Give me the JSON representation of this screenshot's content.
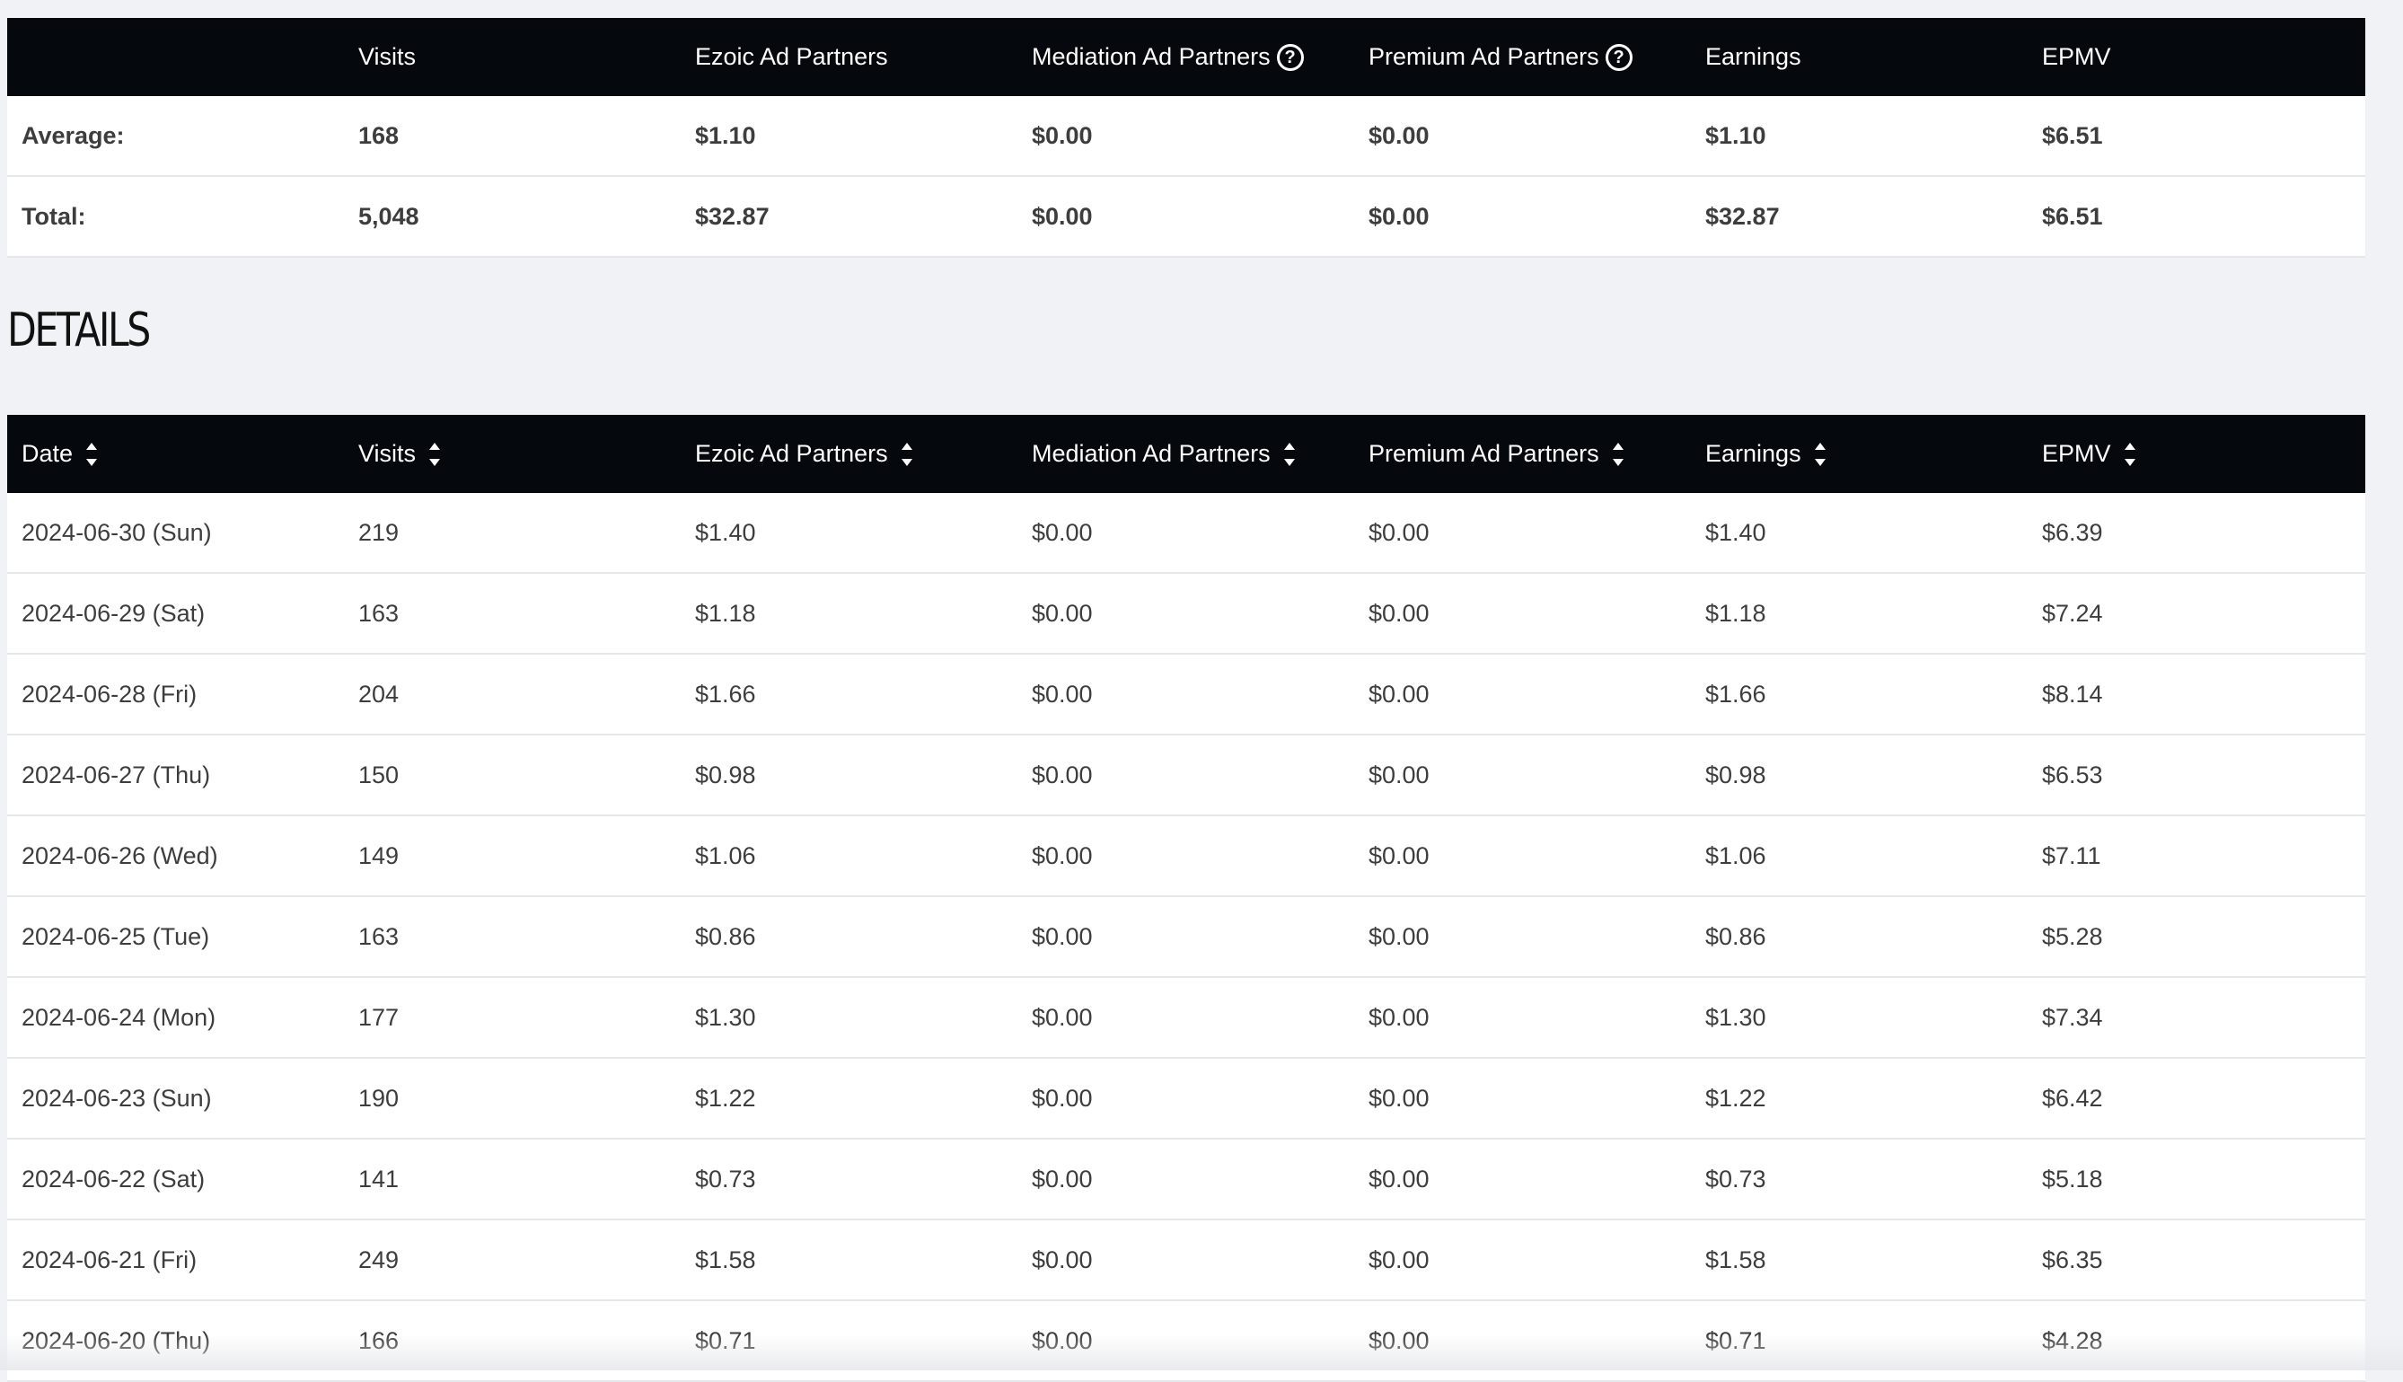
{
  "summary": {
    "headers": [
      "",
      "Visits",
      "Ezoic Ad Partners",
      "Mediation Ad Partners",
      "Premium Ad Partners",
      "Earnings",
      "EPMV"
    ],
    "rows": [
      [
        "Average:",
        "168",
        "$1.10",
        "$0.00",
        "$0.00",
        "$1.10",
        "$6.51"
      ],
      [
        "Total:",
        "5,048",
        "$32.87",
        "$0.00",
        "$0.00",
        "$32.87",
        "$6.51"
      ]
    ]
  },
  "details": {
    "title": "DETAILS",
    "headers": [
      "Date",
      "Visits",
      "Ezoic Ad Partners",
      "Mediation Ad Partners",
      "Premium Ad Partners",
      "Earnings",
      "EPMV"
    ],
    "rows": [
      [
        "2024-06-30 (Sun)",
        "219",
        "$1.40",
        "$0.00",
        "$0.00",
        "$1.40",
        "$6.39"
      ],
      [
        "2024-06-29 (Sat)",
        "163",
        "$1.18",
        "$0.00",
        "$0.00",
        "$1.18",
        "$7.24"
      ],
      [
        "2024-06-28 (Fri)",
        "204",
        "$1.66",
        "$0.00",
        "$0.00",
        "$1.66",
        "$8.14"
      ],
      [
        "2024-06-27 (Thu)",
        "150",
        "$0.98",
        "$0.00",
        "$0.00",
        "$0.98",
        "$6.53"
      ],
      [
        "2024-06-26 (Wed)",
        "149",
        "$1.06",
        "$0.00",
        "$0.00",
        "$1.06",
        "$7.11"
      ],
      [
        "2024-06-25 (Tue)",
        "163",
        "$0.86",
        "$0.00",
        "$0.00",
        "$0.86",
        "$5.28"
      ],
      [
        "2024-06-24 (Mon)",
        "177",
        "$1.30",
        "$0.00",
        "$0.00",
        "$1.30",
        "$7.34"
      ],
      [
        "2024-06-23 (Sun)",
        "190",
        "$1.22",
        "$0.00",
        "$0.00",
        "$1.22",
        "$6.42"
      ],
      [
        "2024-06-22 (Sat)",
        "141",
        "$0.73",
        "$0.00",
        "$0.00",
        "$0.73",
        "$5.18"
      ],
      [
        "2024-06-21 (Fri)",
        "249",
        "$1.58",
        "$0.00",
        "$0.00",
        "$1.58",
        "$6.35"
      ],
      [
        "2024-06-20 (Thu)",
        "166",
        "$0.71",
        "$0.00",
        "$0.00",
        "$0.71",
        "$4.28"
      ]
    ]
  },
  "icons": {
    "help": "question-circle-icon",
    "help_glyph": "?",
    "sort": "sort-icon"
  },
  "colors": {
    "header_bg": "#05080c",
    "page_bg": "#f1f2f6",
    "row_bg": "#ffffff"
  }
}
